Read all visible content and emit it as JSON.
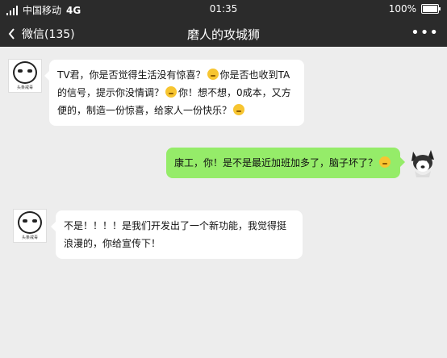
{
  "status": {
    "carrier": "中国移动",
    "network": "4G",
    "time": "01:35",
    "battery": "100%",
    "battery_level": 1.0
  },
  "nav": {
    "back_label": "微信(135)",
    "title": "磨人的攻城狮",
    "more": "•••"
  },
  "messages": [
    {
      "side": "left",
      "avatar_caption": "头条戒毒",
      "parts": [
        "TV君，你是否觉得生活没有惊喜？",
        "你是否也收到TA的信号，提示你没情调？",
        "你！想不想，0成本，又方便的，制造一份惊喜，给家人一份快乐？",
        ""
      ]
    },
    {
      "side": "right",
      "parts": [
        "康工，你！是不是最近加班加多了，脑子坏了？",
        ""
      ]
    },
    {
      "side": "left",
      "avatar_caption": "头条戒毒",
      "parts": [
        "不是！！！！是我们开发出了一个新功能，我觉得挺浪漫的，你给宣传下！"
      ]
    }
  ]
}
